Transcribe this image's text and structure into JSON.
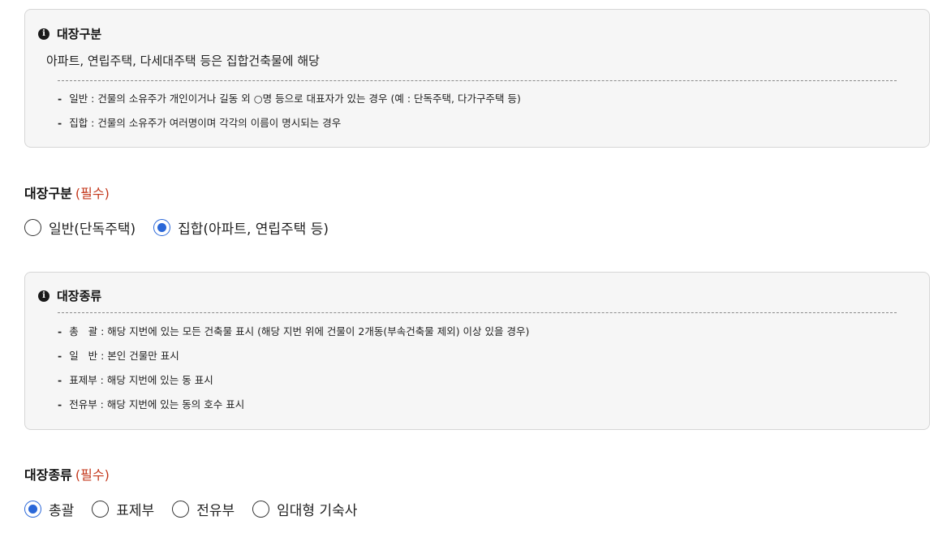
{
  "register_type_info": {
    "heading": "대장구분",
    "description": "아파트, 연립주택, 다세대주택 등은 집합건축물에 해당",
    "bullets": [
      "일반 : 건물의 소유주가 개인이거나 길동 외 ○명 등으로 대표자가 있는 경우 (예 : 단독주택, 다가구주택 등)",
      "집합 : 건물의 소유주가 여러명이며 각각의 이름이 명시되는 경우"
    ]
  },
  "register_type_field": {
    "label": "대장구분",
    "required": "(필수)",
    "options": [
      {
        "label": "일반(단독주택)",
        "checked": false
      },
      {
        "label": "집합(아파트, 연립주택 등)",
        "checked": true
      }
    ]
  },
  "register_kind_info": {
    "heading": "대장종류",
    "bullets": [
      "총   괄 : 해당 지번에 있는 모든 건축물 표시 (해당 지번 위에 건물이 2개동(부속건축물 제외) 이상 있을 경우)",
      "일   반 : 본인 건물만 표시",
      "표제부 : 해당 지번에 있는 동 표시",
      "전유부 : 해당 지번에 있는 동의 호수 표시"
    ]
  },
  "register_kind_field": {
    "label": "대장종류",
    "required": "(필수)",
    "options": [
      {
        "label": "총괄",
        "checked": true
      },
      {
        "label": "표제부",
        "checked": false
      },
      {
        "label": "전유부",
        "checked": false
      },
      {
        "label": "임대형 기숙사",
        "checked": false
      }
    ]
  },
  "icons": {
    "info": "info-icon",
    "bullet": "dash"
  },
  "colors": {
    "accent": "#2a67d8",
    "required": "#c4391d",
    "box_background": "#f6f6f6"
  }
}
